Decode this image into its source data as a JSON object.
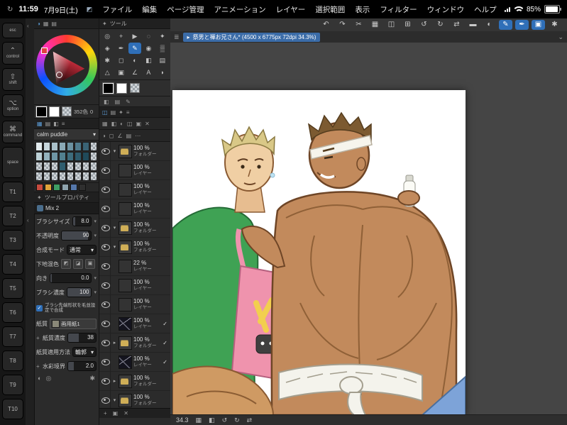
{
  "status": {
    "time": "11:59",
    "date": "7月9日(土)",
    "battery": "85%"
  },
  "menu": {
    "items": [
      "ファイル",
      "編集",
      "ページ管理",
      "アニメーション",
      "レイヤー",
      "選択範囲",
      "表示",
      "フィルター",
      "ウィンドウ",
      "ヘルプ"
    ]
  },
  "cmdbar": {
    "icons": [
      {
        "g": "↶",
        "n": "undo",
        "cls": ""
      },
      {
        "g": "↷",
        "n": "redo",
        "cls": ""
      },
      {
        "g": "✂",
        "n": "cut",
        "cls": ""
      },
      {
        "g": "▦",
        "n": "copy",
        "cls": ""
      },
      {
        "g": "◫",
        "n": "paste",
        "cls": ""
      },
      {
        "g": "⊞",
        "n": "grid",
        "cls": ""
      },
      {
        "g": "↺",
        "n": "rotate-left",
        "cls": ""
      },
      {
        "g": "↻",
        "n": "rotate-right",
        "cls": ""
      },
      {
        "g": "⇄",
        "n": "flip-horizontal",
        "cls": ""
      },
      {
        "g": "▬",
        "n": "trim",
        "cls": ""
      },
      {
        "g": "◐",
        "n": "tone",
        "cls": ""
      },
      {
        "g": "✎",
        "n": "pen-input",
        "cls": "active"
      },
      {
        "g": "✒",
        "n": "brush-input",
        "cls": "active"
      },
      {
        "g": "▣",
        "n": "selection-mode",
        "cls": "active"
      },
      {
        "g": "✱",
        "n": "modifier-settings",
        "cls": ""
      }
    ]
  },
  "doc": {
    "tab_title": "祭男と褌お兄さん* (4500 x 6775px 72dpi 34.3%)",
    "zoom": "34.3"
  },
  "rail": {
    "items": [
      {
        "label": "esc",
        "sym": "",
        "cls": "esc"
      },
      {
        "label": "control",
        "sym": "⌃",
        "cls": "mod"
      },
      {
        "label": "shift",
        "sym": "⇧",
        "cls": "mod"
      },
      {
        "label": "option",
        "sym": "⌥",
        "cls": "mod"
      },
      {
        "label": "command",
        "sym": "⌘",
        "cls": "mod"
      },
      {
        "label": "space",
        "sym": "",
        "cls": "space"
      },
      {
        "label": "T1",
        "sym": "",
        "cls": "t"
      },
      {
        "label": "T2",
        "sym": "",
        "cls": "t"
      },
      {
        "label": "T3",
        "sym": "",
        "cls": "t"
      },
      {
        "label": "T4",
        "sym": "",
        "cls": "t"
      },
      {
        "label": "T5",
        "sym": "",
        "cls": "t"
      },
      {
        "label": "T6",
        "sym": "",
        "cls": "t"
      },
      {
        "label": "T7",
        "sym": "",
        "cls": "t"
      },
      {
        "label": "T8",
        "sym": "",
        "cls": "t"
      },
      {
        "label": "T9",
        "sym": "",
        "cls": "t"
      },
      {
        "label": "T10",
        "sym": "",
        "cls": "t"
      }
    ]
  },
  "color_wheel": {
    "count": "352色",
    "sub": "0"
  },
  "colorset": {
    "name": "calm puddle",
    "palette": [
      "#e3ebee",
      "#c7d6dc",
      "#a9c0c9",
      "#8aa9b5",
      "#6c92a1",
      "#507a8c",
      "#3a6375",
      "checker",
      "#bcd0d6",
      "#93b2bd",
      "#6f96a5",
      "#52808f",
      "#3e6d7d",
      "#2e5a6b",
      "#204a5a",
      "checker",
      "checker",
      "checker",
      "checker",
      "#2f5d6e",
      "checker",
      "checker",
      "checker",
      "checker",
      "checker",
      "checker",
      "checker",
      "checker",
      "checker",
      "checker",
      "checker",
      "checker"
    ],
    "chips": [
      "#c84b3f",
      "#e0a33a",
      "#3f9e63",
      "#8fa3ad",
      "#5577aa",
      "#2f2f2f"
    ]
  },
  "tools": {
    "title": "ツール",
    "grid": [
      {
        "g": "◎",
        "n": "zoom-tool",
        "cls": ""
      },
      {
        "g": "+",
        "n": "move-tool",
        "cls": ""
      },
      {
        "g": "▶",
        "n": "operation-tool",
        "cls": ""
      },
      {
        "g": "◌",
        "n": "lasso-tool",
        "cls": ""
      },
      {
        "g": "✦",
        "n": "wand-tool",
        "cls": ""
      },
      {
        "g": "◈",
        "n": "eyedropper-tool",
        "cls": ""
      },
      {
        "g": "✒",
        "n": "pen-tool",
        "cls": ""
      },
      {
        "g": "✎",
        "n": "pencil-tool",
        "cls": "active"
      },
      {
        "g": "◉",
        "n": "brush-tool",
        "cls": ""
      },
      {
        "g": "▒",
        "n": "airbrush-tool",
        "cls": ""
      },
      {
        "g": "✱",
        "n": "decoration-tool",
        "cls": ""
      },
      {
        "g": "◻",
        "n": "eraser-tool",
        "cls": ""
      },
      {
        "g": "◐",
        "n": "blend-tool",
        "cls": ""
      },
      {
        "g": "◧",
        "n": "fill-tool",
        "cls": ""
      },
      {
        "g": "▤",
        "n": "gradient-tool",
        "cls": ""
      },
      {
        "g": "△",
        "n": "figure-tool",
        "cls": ""
      },
      {
        "g": "▣",
        "n": "frame-tool",
        "cls": ""
      },
      {
        "g": "∠",
        "n": "ruler-tool",
        "cls": ""
      },
      {
        "g": "A",
        "n": "text-tool",
        "cls": ""
      },
      {
        "g": "◗",
        "n": "balloon-tool",
        "cls": ""
      }
    ]
  },
  "tool_property": {
    "title": "ツールプロパティ",
    "subtool": "Mix 2",
    "brush_size": {
      "label": "ブラシサイズ",
      "value": "8.0"
    },
    "opacity": {
      "label": "不透明度",
      "value": "90"
    },
    "blend": {
      "label": "合成モード",
      "value": "通常"
    },
    "base_mix": {
      "label": "下地混色"
    },
    "direction": {
      "label": "向き",
      "value": "0.0"
    },
    "density": {
      "label": "ブラシ濃度",
      "value": "100"
    },
    "tip_checkbox": "ブラシ先端形状を毛並設定で合成",
    "texture": {
      "label": "紙質",
      "value": "画用紙1"
    },
    "texture_density": {
      "label": "紙質濃度",
      "value": "38"
    },
    "texture_method": {
      "label": "紙質適用方法",
      "value": "輪郭"
    },
    "watercolor_edge": {
      "label": "水彩境界",
      "value": "2.0"
    }
  },
  "layers": {
    "rows": [
      {
        "opacity": "100 %",
        "type": "フォルダー",
        "thumb": "folder",
        "arrow": "▾",
        "check": ""
      },
      {
        "opacity": "100 %",
        "type": "レイヤー",
        "thumb": "checker",
        "arrow": "",
        "check": ""
      },
      {
        "opacity": "100 %",
        "type": "レイヤー",
        "thumb": "checker",
        "arrow": "",
        "check": ""
      },
      {
        "opacity": "100 %",
        "type": "レイヤー",
        "thumb": "checker",
        "arrow": "",
        "check": ""
      },
      {
        "opacity": "100 %",
        "type": "フォルダー",
        "thumb": "folder",
        "arrow": "▾",
        "check": ""
      },
      {
        "opacity": "100 %",
        "type": "フォルダー",
        "thumb": "folder",
        "arrow": "▾",
        "check": ""
      },
      {
        "opacity": "22 %",
        "type": "レイヤー",
        "thumb": "checker",
        "arrow": "",
        "check": ""
      },
      {
        "opacity": "100 %",
        "type": "レイヤー",
        "thumb": "checker",
        "arrow": "",
        "check": ""
      },
      {
        "opacity": "100 %",
        "type": "レイヤー",
        "thumb": "checker",
        "arrow": "",
        "check": ""
      },
      {
        "opacity": "100 %",
        "type": "レイヤー",
        "thumb": "dark",
        "arrow": "",
        "check": "✓"
      },
      {
        "opacity": "100 %",
        "type": "フォルダー",
        "thumb": "folder",
        "arrow": "▸",
        "check": "✓"
      },
      {
        "opacity": "100 %",
        "type": "レイヤー",
        "thumb": "dark",
        "arrow": "",
        "check": "✓"
      },
      {
        "opacity": "100 %",
        "type": "フォルダー",
        "thumb": "folder",
        "arrow": "▸",
        "check": ""
      },
      {
        "opacity": "100 %",
        "type": "フォルダー",
        "thumb": "folder",
        "arrow": "▾",
        "check": ""
      }
    ]
  },
  "bottombar": {
    "icons": [
      {
        "g": "▦",
        "n": "navigator"
      },
      {
        "g": "◧",
        "n": "fit-screen"
      },
      {
        "g": "↺",
        "n": "rotate-view-left"
      },
      {
        "g": "↻",
        "n": "rotate-view-right"
      },
      {
        "g": "⇄",
        "n": "flip-view"
      }
    ]
  },
  "accent": {
    "selection_blue": "#2f6fb8",
    "tab_blue": "#3b6ca8"
  }
}
